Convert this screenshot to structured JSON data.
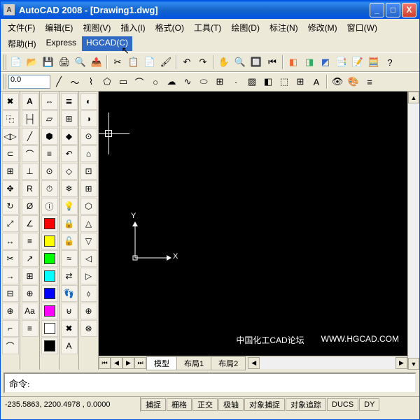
{
  "title": "AutoCAD 2008 - [Drawing1.dwg]",
  "menu": {
    "file": "文件(F)",
    "edit": "编辑(E)",
    "view": "视图(V)",
    "insert": "插入(I)",
    "format": "格式(O)",
    "tools": "工具(T)",
    "draw": "绘图(D)",
    "annotate": "标注(N)",
    "modify": "修改(M)",
    "window": "窗口(W)",
    "help": "帮助(H)",
    "express": "Express",
    "hgcad": "HGCAD(C)"
  },
  "toolbar2": {
    "scale": "0.0"
  },
  "canvas": {
    "ucs_x": "X",
    "ucs_y": "Y",
    "watermark1": "中国化工CAD论坛",
    "watermark2": "WWW.HGCAD.COM"
  },
  "tabs": {
    "model": "模型",
    "layout1": "布局1",
    "layout2": "布局2"
  },
  "command": {
    "prompt": "命令:"
  },
  "status": {
    "coords": "-235.5863, 2200.4978 , 0.0000",
    "snap": "捕捉",
    "grid": "栅格",
    "ortho": "正交",
    "polar": "极轴",
    "osnap": "对象捕捉",
    "otrack": "对象追踪",
    "ducs": "DUCS",
    "dyn": "DY"
  },
  "swatches": [
    "#ff0000",
    "#ffff00",
    "#00ff00",
    "#00ffff",
    "#0000ff",
    "#ff00ff",
    "#ffffff",
    "#000000"
  ]
}
